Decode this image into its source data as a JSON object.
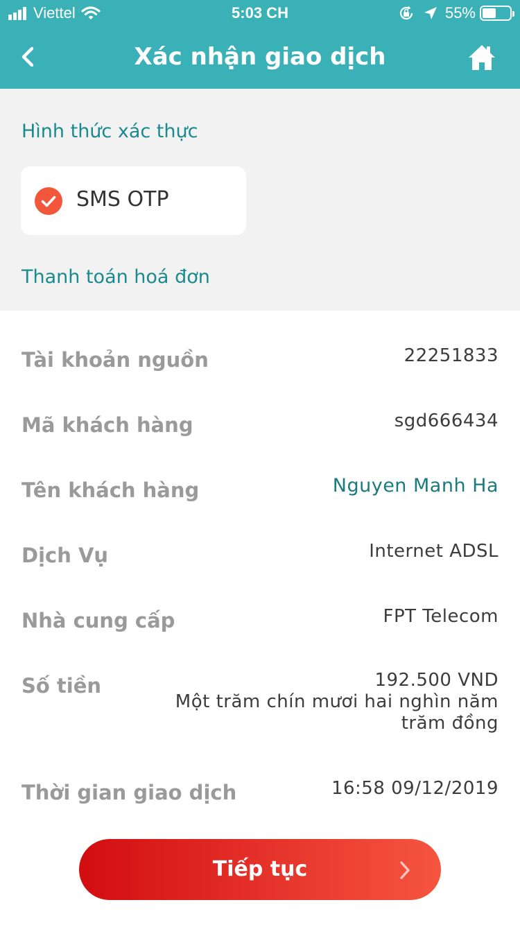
{
  "status_bar": {
    "carrier": "Viettel",
    "time": "5:03 CH",
    "battery_percent": "55%",
    "battery_level": 0.55,
    "icons": [
      "signal-icon",
      "wifi-icon",
      "orientation-lock-icon",
      "location-arrow-icon",
      "battery-icon"
    ]
  },
  "nav": {
    "title": "Xác nhận giao dịch",
    "back_icon": "chevron-left-icon",
    "home_icon": "home-icon"
  },
  "auth": {
    "section_label": "Hình thức xác thực",
    "method": "SMS OTP",
    "selected": true
  },
  "payment": {
    "section_label": "Thanh toán hoá đơn",
    "rows": [
      {
        "label": "Tài khoản nguồn",
        "value": "22251833"
      },
      {
        "label": "Mã khách hàng",
        "value": "sgd666434"
      },
      {
        "label": "Tên khách hàng",
        "value": "Nguyen Manh Ha"
      },
      {
        "label": "Dịch Vụ",
        "value": "Internet ADSL"
      },
      {
        "label": "Nhà cung cấp",
        "value": "FPT Telecom"
      },
      {
        "label": "Số tiền",
        "value": "192.500  VND",
        "value_words": "Một trăm chín mươi hai nghìn năm trăm đồng"
      },
      {
        "label": "Thời gian giao dịch",
        "value": "16:58 09/12/2019"
      }
    ]
  },
  "actions": {
    "continue_label": "Tiếp tục"
  },
  "colors": {
    "header": "#3ab1b6",
    "accent_teal": "#1a8a8e",
    "button_start": "#d20d10",
    "button_end": "#f5553f",
    "check": "#f2573b"
  }
}
